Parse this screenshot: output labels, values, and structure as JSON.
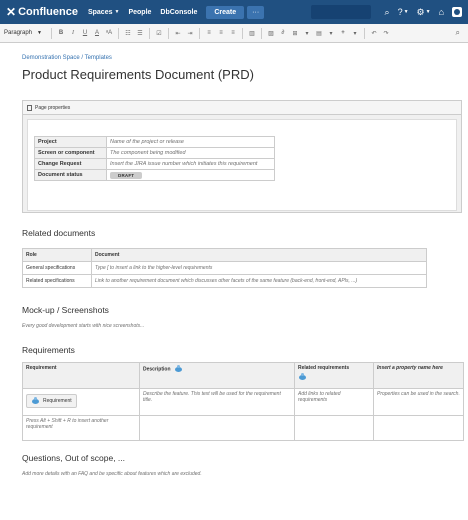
{
  "topnav": {
    "logo": "Confluence",
    "logo_mark": "✕",
    "links": [
      "Spaces",
      "People",
      "DbConsole"
    ],
    "create_label": "Create",
    "more_label": "···",
    "help_glyph": "?",
    "settings_glyph": "⚙"
  },
  "toolbar": {
    "paragraph_label": "Paragraph",
    "bold": "B",
    "italic": "I",
    "underline": "U",
    "text_color": "A",
    "text_size": "ᵃA",
    "bullet_list": "☷",
    "numbered_list": "☰",
    "task": "☑",
    "outdent": "⇤",
    "indent": "⇥",
    "align_left": "≡",
    "align_center": "≡",
    "align_right": "≡",
    "layout": "▥",
    "image": "▨",
    "link": "∂",
    "table": "⊞",
    "template": "▤",
    "insert": "+",
    "undo": "↶",
    "redo": "↷",
    "search_glyph": "⌕"
  },
  "breadcrumb": "Demonstration Space / Templates",
  "page_title": "Product Requirements Document (PRD)",
  "page_properties": {
    "header": "Page properties",
    "rows": [
      {
        "key": "Project",
        "value": "Name of the project or release"
      },
      {
        "key": "Screen or component",
        "value": "The component being modified"
      },
      {
        "key": "Change Request",
        "value": "Insert the JIRA issue number which initiates this requirement"
      },
      {
        "key": "Document status",
        "value": "DRAFT"
      }
    ]
  },
  "related_documents": {
    "heading": "Related documents",
    "columns": [
      "Role",
      "Document"
    ],
    "rows": [
      {
        "role": "General specifications",
        "doc": "Type [ to insert a link to the higher-level requirements"
      },
      {
        "role": "Related specifications",
        "doc": "Link to another requirement document which discusses other facets of the same feature (back-end, front-end, APIs, ...)"
      }
    ]
  },
  "mockups": {
    "heading": "Mock-up / Screenshots",
    "note": "Every good development starts with nice screenshots..."
  },
  "requirements": {
    "heading": "Requirements",
    "columns": [
      "Requirement",
      "Description",
      "Related requirements",
      "Insert a property name here"
    ],
    "row1": {
      "button": "Requirement",
      "description": "Describe the feature. This text will be used for the requirement title.",
      "related": "Add links to related requirements",
      "property": "Properties can be used in the search."
    },
    "row2": {
      "hint": "Press Alt + Shift + R to insert another requirement"
    }
  },
  "questions": {
    "heading": "Questions, Out of scope, ...",
    "note": "Add more details with an FAQ and be specific about features which are excluded."
  },
  "colors": {
    "nav_bg": "#205081",
    "link": "#3572b0",
    "create_bg": "#3b73af"
  }
}
